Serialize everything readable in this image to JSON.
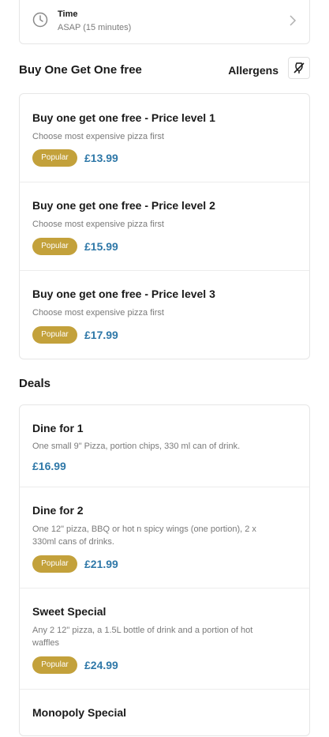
{
  "time": {
    "label": "Time",
    "value": "ASAP (15 minutes)"
  },
  "bogof": {
    "title": "Buy One Get One free",
    "allergens_label": "Allergens",
    "items": [
      {
        "name": "Buy one get one free - Price level 1",
        "desc": "Choose most expensive pizza first",
        "badge": "Popular",
        "price": "£13.99"
      },
      {
        "name": "Buy one get one free - Price level 2",
        "desc": "Choose most expensive pizza first",
        "badge": "Popular",
        "price": "£15.99"
      },
      {
        "name": "Buy one get one free - Price level 3",
        "desc": "Choose most expensive pizza first",
        "badge": "Popular",
        "price": "£17.99"
      }
    ]
  },
  "deals": {
    "title": "Deals",
    "items": [
      {
        "name": "Dine for 1",
        "desc": "One small 9\" Pizza, portion chips, 330 ml can of drink.",
        "badge": "",
        "price": "£16.99"
      },
      {
        "name": "Dine for 2",
        "desc": "One 12\" pizza, BBQ or hot n spicy wings (one portion), 2 x 330ml cans of drinks.",
        "badge": "Popular",
        "price": "£21.99"
      },
      {
        "name": "Sweet Special",
        "desc": "Any 2 12\" pizza, a 1.5L bottle of drink and a portion of hot waffles",
        "badge": "Popular",
        "price": "£24.99"
      },
      {
        "name": "Monopoly Special",
        "desc": "",
        "badge": "",
        "price": ""
      }
    ]
  }
}
